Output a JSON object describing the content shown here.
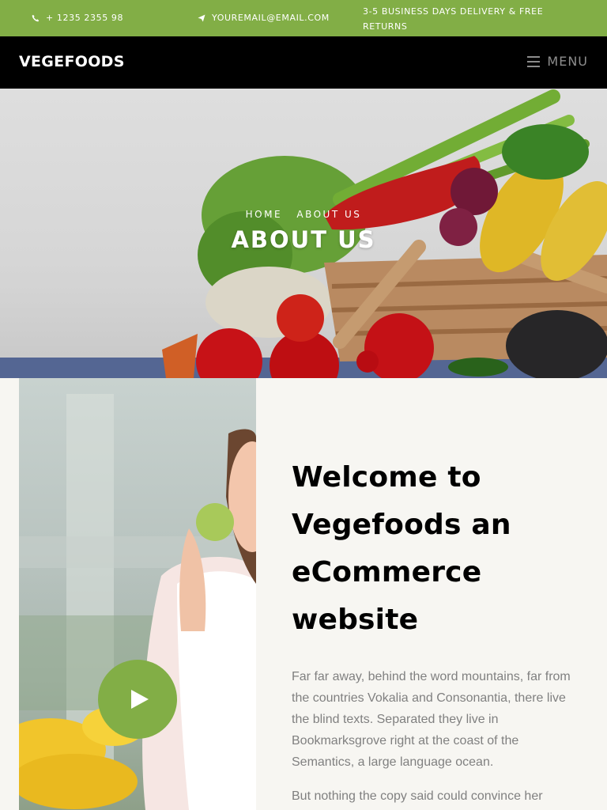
{
  "topbar": {
    "phone": "+ 1235 2355 98",
    "email": "YOUREMAIL@EMAIL.COM",
    "delivery": "3-5 BUSINESS DAYS DELIVERY & FREE RETURNS",
    "bg_color": "#82ae46"
  },
  "navbar": {
    "brand": "VEGEFOODS",
    "menu_label": "MENU"
  },
  "hero": {
    "breadcrumb_home": "HOME",
    "breadcrumb_current": "ABOUT US",
    "title": "ABOUT US"
  },
  "about": {
    "heading": "Welcome to Vegefoods an eCommerce website",
    "paragraph_1": "Far far away, behind the word mountains, far from the countries Vokalia and Consonantia, there live the blind texts. Separated they live in Bookmarksgrove right at the coast of the Semantics, a large language ocean.",
    "paragraph_2": "But nothing the copy said could convince her",
    "accent_color": "#82ae46"
  }
}
